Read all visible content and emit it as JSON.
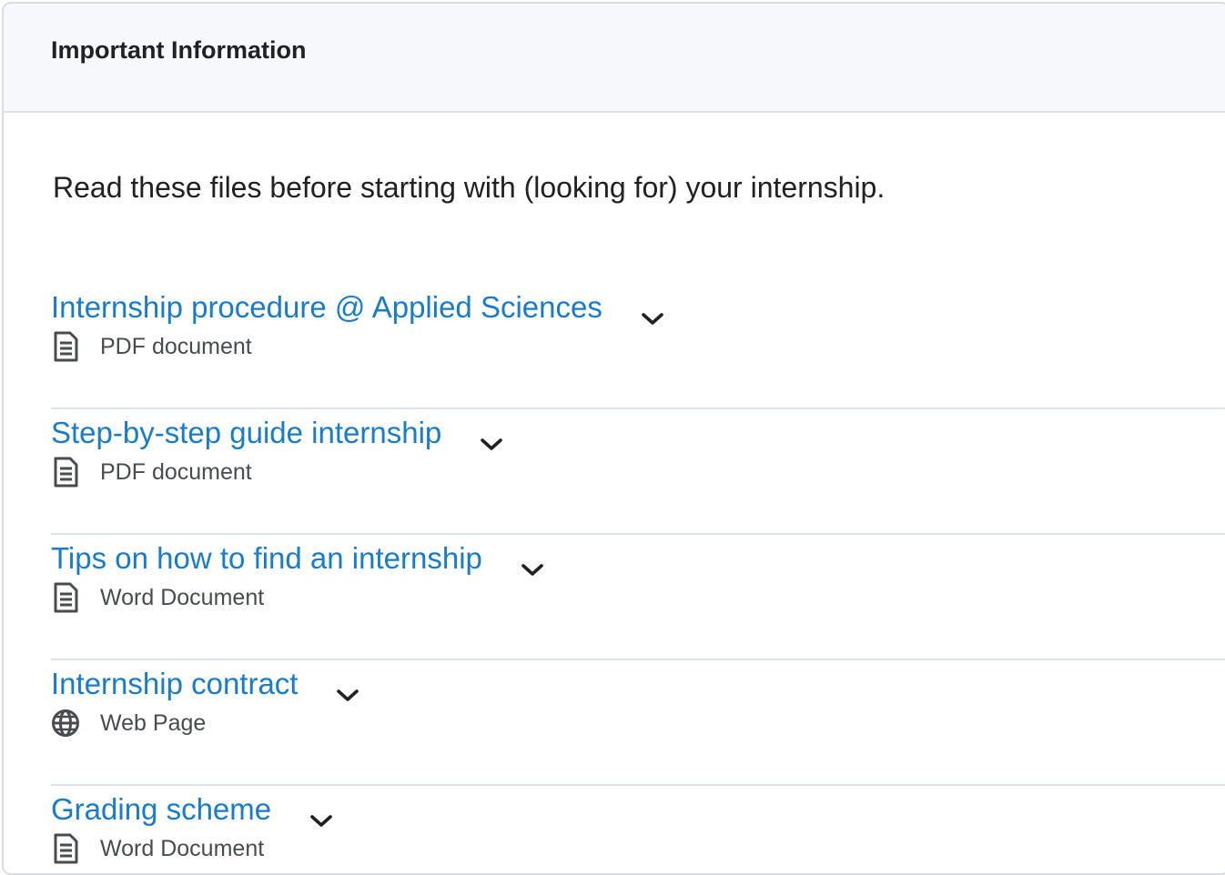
{
  "panel": {
    "title": "Important Information",
    "intro": "Read these files before starting with (looking for) your internship."
  },
  "items": [
    {
      "title": "Internship procedure @ Applied Sciences",
      "type": "PDF document",
      "icon": "document-icon"
    },
    {
      "title": "Step-by-step guide internship",
      "type": "PDF document",
      "icon": "document-icon"
    },
    {
      "title": "Tips on how to find an internship",
      "type": "Word Document",
      "icon": "document-icon"
    },
    {
      "title": "Internship contract",
      "type": "Web Page",
      "icon": "globe-icon"
    },
    {
      "title": "Grading scheme",
      "type": "Word Document",
      "icon": "document-icon"
    }
  ],
  "colors": {
    "link": "#1a7cc8",
    "text": "#202122",
    "muted": "#494c4e",
    "header_bg": "#f6f8fb",
    "divider": "#dfe3e8"
  }
}
